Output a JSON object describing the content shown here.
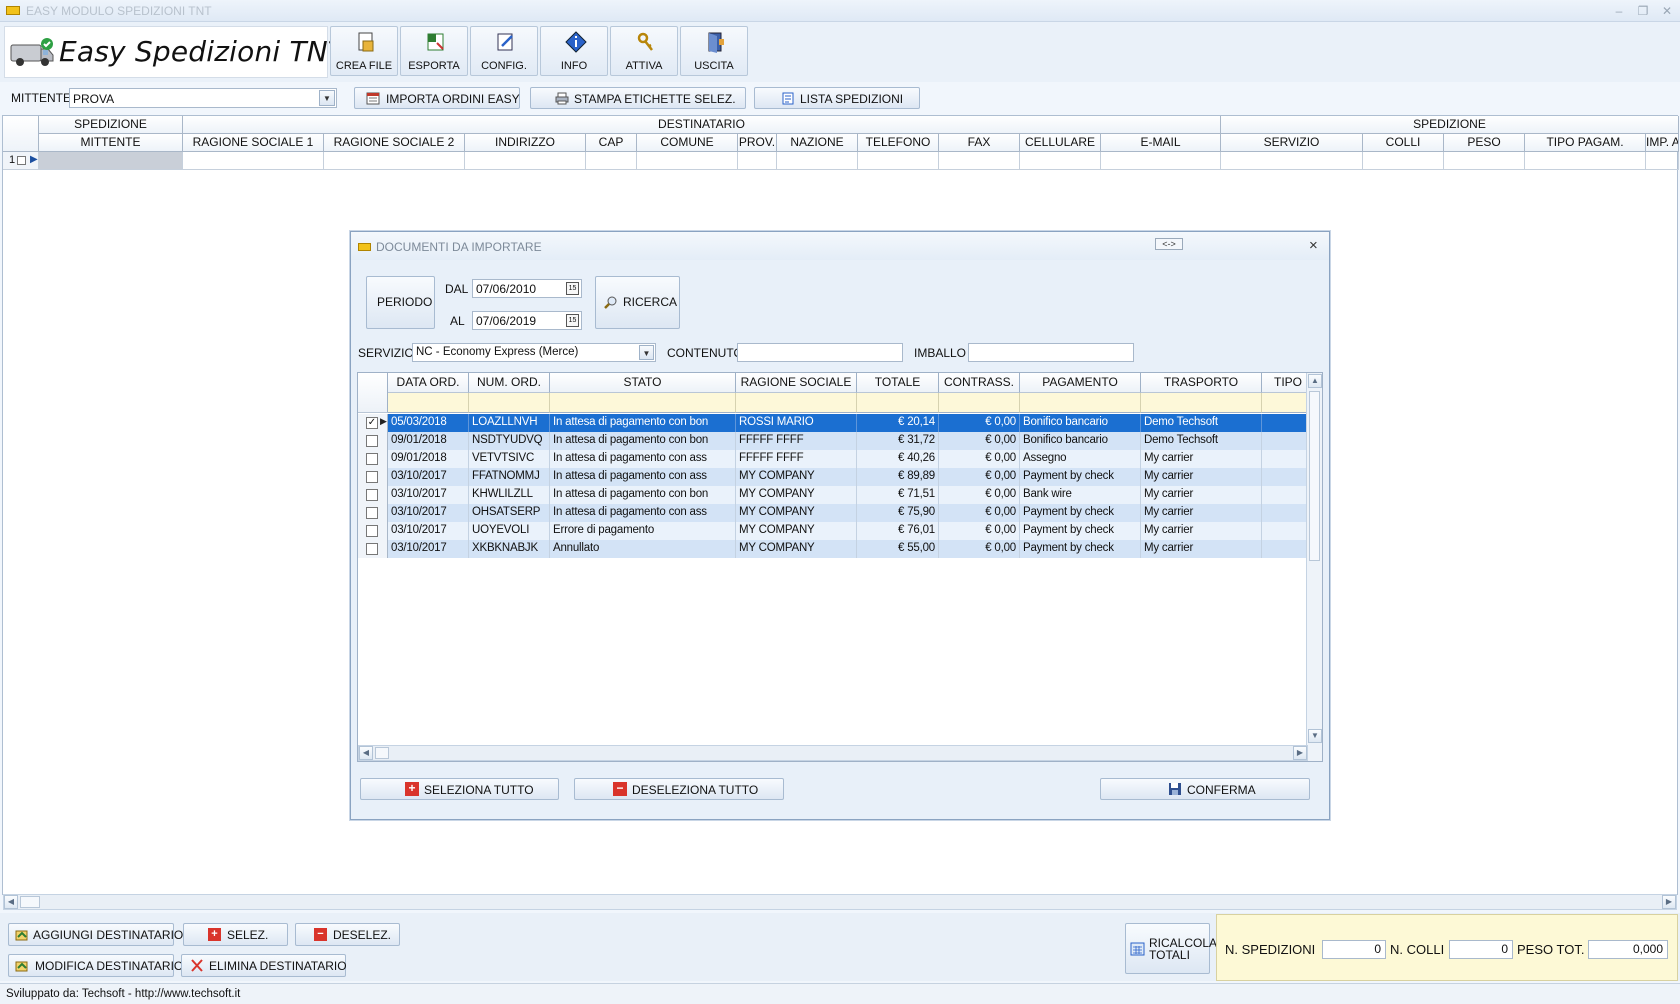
{
  "window": {
    "title": "EASY MODULO SPEDIZIONI TNT"
  },
  "brand": {
    "title": "Easy Spedizioni TNT"
  },
  "toolbar": {
    "crea_file": "CREA FILE",
    "esporta": "ESPORTA",
    "config": "CONFIG.",
    "info": "INFO",
    "attiva": "ATTIVA",
    "uscita": "USCITA"
  },
  "mittente": {
    "label": "MITTENTE",
    "value": "PROVA",
    "importa": "IMPORTA ORDINI EASY",
    "stampa": "STAMPA ETICHETTE SELEZ.",
    "lista": "LISTA SPEDIZIONI"
  },
  "grid": {
    "groups": [
      "SPEDIZIONE",
      "DESTINATARIO",
      "SPEDIZIONE"
    ],
    "columns": [
      "MITTENTE",
      "RAGIONE SOCIALE 1",
      "RAGIONE SOCIALE 2",
      "INDIRIZZO",
      "CAP",
      "COMUNE",
      "PROV.",
      "NAZIONE",
      "TELEFONO",
      "FAX",
      "CELLULARE",
      "E-MAIL",
      "SERVIZIO",
      "COLLI",
      "PESO",
      "TIPO PAGAM.",
      "IMP. A"
    ],
    "row_number": "1"
  },
  "dialog": {
    "title": "DOCUMENTI DA IMPORTARE",
    "resize": "<->",
    "close": "×",
    "periodo": "PERIODO",
    "dal_label": "DAL",
    "dal": "07/06/2010",
    "al_label": "AL",
    "al": "07/06/2019",
    "ricerca": "RICERCA",
    "servizio_label": "SERVIZIO",
    "servizio": "NC - Economy Express (Merce)",
    "contenuto_label": "CONTENUTO",
    "imballo_label": "IMBALLO",
    "columns": [
      "DATA ORD.",
      "NUM. ORD.",
      "STATO",
      "RAGIONE SOCIALE",
      "TOTALE",
      "CONTRASS.",
      "PAGAMENTO",
      "TRASPORTO",
      "TIPO C"
    ],
    "rows": [
      {
        "checked": true,
        "data": "05/03/2018",
        "num": "LOAZLLNVH",
        "stato": "In attesa di pagamento con bon",
        "ragione": "ROSSI MARIO",
        "totale": "€ 20,14",
        "contrass": "€ 0,00",
        "pagamento": "Bonifico bancario",
        "trasporto": "Demo Techsoft"
      },
      {
        "checked": false,
        "data": "09/01/2018",
        "num": "NSDTYUDVQ",
        "stato": "In attesa di pagamento con bon",
        "ragione": "FFFFF FFFF",
        "totale": "€ 31,72",
        "contrass": "€ 0,00",
        "pagamento": "Bonifico bancario",
        "trasporto": "Demo Techsoft"
      },
      {
        "checked": false,
        "data": "09/01/2018",
        "num": "VETVTSIVC",
        "stato": "In attesa di pagamento con ass",
        "ragione": "FFFFF FFFF",
        "totale": "€ 40,26",
        "contrass": "€ 0,00",
        "pagamento": "Assegno",
        "trasporto": "My carrier"
      },
      {
        "checked": false,
        "data": "03/10/2017",
        "num": "FFATNOMMJ",
        "stato": "In attesa di pagamento con ass",
        "ragione": "MY COMPANY",
        "totale": "€ 89,89",
        "contrass": "€ 0,00",
        "pagamento": "Payment by check",
        "trasporto": "My carrier"
      },
      {
        "checked": false,
        "data": "03/10/2017",
        "num": "KHWLILZLL",
        "stato": "In attesa di pagamento con bon",
        "ragione": "MY COMPANY",
        "totale": "€ 71,51",
        "contrass": "€ 0,00",
        "pagamento": "Bank wire",
        "trasporto": "My carrier"
      },
      {
        "checked": false,
        "data": "03/10/2017",
        "num": "OHSATSERP",
        "stato": "In attesa di pagamento con ass",
        "ragione": "MY COMPANY",
        "totale": "€ 75,90",
        "contrass": "€ 0,00",
        "pagamento": "Payment by check",
        "trasporto": "My carrier"
      },
      {
        "checked": false,
        "data": "03/10/2017",
        "num": "UOYEVOLI",
        "stato": "Errore di pagamento",
        "ragione": "MY COMPANY",
        "totale": "€ 76,01",
        "contrass": "€ 0,00",
        "pagamento": "Payment by check",
        "trasporto": "My carrier"
      },
      {
        "checked": false,
        "data": "03/10/2017",
        "num": "XKBKNABJK",
        "stato": "Annullato",
        "ragione": "MY COMPANY",
        "totale": "€ 55,00",
        "contrass": "€ 0,00",
        "pagamento": "Payment by check",
        "trasporto": "My carrier"
      }
    ],
    "seleziona_tutto": "SELEZIONA TUTTO",
    "deseleziona_tutto": "DESELEZIONA TUTTO",
    "conferma": "CONFERMA"
  },
  "bottom": {
    "aggiungi": "AGGIUNGI DESTINATARIO",
    "selez": "SELEZ.",
    "deselez": "DESELEZ.",
    "modifica": "MODIFICA DESTINATARIO",
    "elimina": "ELIMINA DESTINATARIO",
    "ricalcola_1": "RICALCOLA",
    "ricalcola_2": "TOTALI",
    "n_spedizioni_label": "N. SPEDIZIONI",
    "n_spedizioni": "0",
    "n_colli_label": "N. COLLI",
    "n_colli": "0",
    "peso_tot_label": "PESO TOT.",
    "peso_tot": "0,000"
  },
  "status": {
    "text": "Sviluppato da: Techsoft - http://www.techsoft.it"
  },
  "colors": {
    "selected_row": "#1b6fd1",
    "row_alt": "#d3e3f6",
    "filter_row": "#fdf8d9",
    "totals_bg": "#fdf9d6"
  },
  "icons": [
    "van-icon",
    "file-icon",
    "excel-icon",
    "config-icon",
    "info-icon",
    "keys-icon",
    "exit-icon",
    "import-icon",
    "printer-icon",
    "list-icon",
    "calendar-icon",
    "search-icon",
    "plus-icon",
    "minus-icon",
    "save-icon",
    "calculator-icon",
    "add-user-icon",
    "delete-icon"
  ]
}
